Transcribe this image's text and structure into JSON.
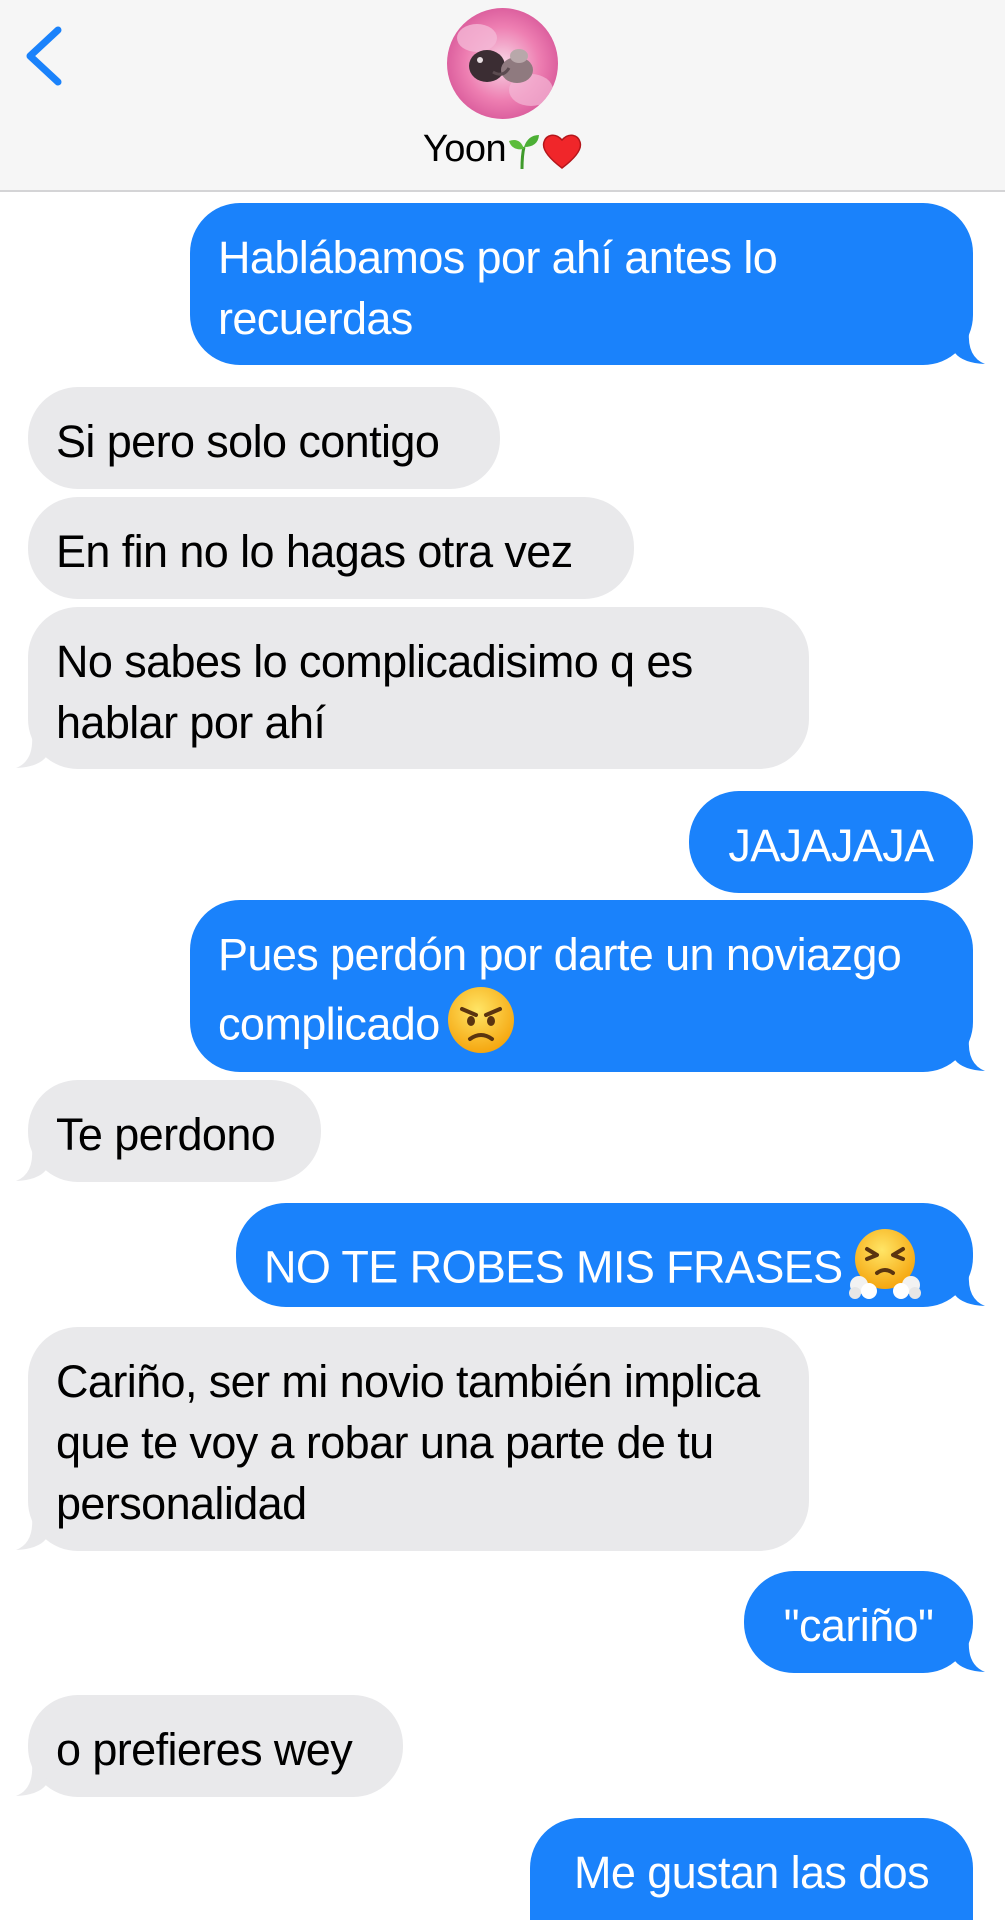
{
  "header": {
    "contact_name": "Yoon",
    "contact_name_emoji": "🌱❤️",
    "back_icon": "chevron-left-icon",
    "avatar_icon": "contact-avatar"
  },
  "colors": {
    "outgoing": "#1a82fb",
    "incoming": "#e9e9eb",
    "accent": "#1a82fb",
    "header_bg": "#f6f6f6"
  },
  "messages": [
    {
      "dir": "out",
      "text": "Hablábamos por ahí antes lo recuerdas"
    },
    {
      "dir": "in",
      "text": "Si pero solo contigo"
    },
    {
      "dir": "in",
      "text": "En fin no lo hagas otra vez"
    },
    {
      "dir": "in",
      "text": "No sabes lo complicadisimo q es hablar por ahí"
    },
    {
      "dir": "out",
      "text": "JAJAJAJA"
    },
    {
      "dir": "out",
      "text": "Pues perdón por darte un noviazgo complicado",
      "emoji": "angry-face-emoji"
    },
    {
      "dir": "in",
      "text": "Te perdono"
    },
    {
      "dir": "out",
      "text": "NO TE ROBES MIS FRASES",
      "emoji": "face-with-steam-emoji"
    },
    {
      "dir": "in",
      "text": "Cariño, ser mi novio también implica que te voy a robar una parte de tu personalidad"
    },
    {
      "dir": "out",
      "text": "\"cariño\""
    },
    {
      "dir": "in",
      "text": "o prefieres wey"
    },
    {
      "dir": "out",
      "text": "Me gustan las dos"
    }
  ]
}
